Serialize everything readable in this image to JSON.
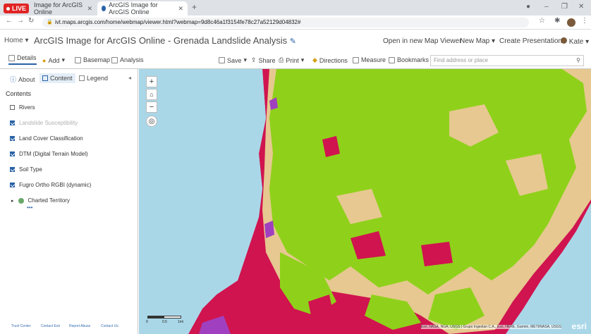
{
  "browser": {
    "live_label": "LIVE",
    "tabs": [
      {
        "title": "Image for ArcGIS Online"
      },
      {
        "title": "ArcGIS Image for ArcGIS Online"
      }
    ],
    "new_tab": "+",
    "url": "ivt.maps.arcgis.com/home/webmap/viewer.html?webmap=9d8c46a1f3154fe78c27a52129d04832#"
  },
  "header": {
    "home": "Home",
    "title": "ArcGIS Image for ArcGIS Online - Grenada Landslide Analysis",
    "open_viewer": "Open in new Map Viewer",
    "new_map": "New Map",
    "create_presentation": "Create Presentation",
    "user": "Kate"
  },
  "toolbar": {
    "details": "Details",
    "add": "Add",
    "basemap": "Basemap",
    "analysis": "Analysis",
    "save": "Save",
    "share": "Share",
    "print": "Print",
    "directions": "Directions",
    "measure": "Measure",
    "bookmarks": "Bookmarks",
    "search_placeholder": "Find address or place"
  },
  "panel": {
    "tabs": [
      "About",
      "Content",
      "Legend"
    ],
    "heading": "Contents",
    "layers": [
      {
        "name": "Rivers",
        "checked": false
      },
      {
        "name": "Landslide Susceptibility",
        "checked": true,
        "dim": true
      },
      {
        "name": "Land Cover Classification",
        "checked": true
      },
      {
        "name": "DTM (Digital Terrain Model)",
        "checked": true
      },
      {
        "name": "Soil Type",
        "checked": true
      },
      {
        "name": "Fugro Ortho RGBI (dynamic)",
        "checked": true
      }
    ],
    "group": "Charted Territory",
    "footer": [
      "Trust Center",
      "Contact Esri",
      "Report Abuse",
      "Contact Us"
    ]
  },
  "map": {
    "attribution": "Esri, NASA, NGA, USGS | Grupo Ingeolan C.A., Esri, HERE, Garmin, METI/NASA, USGS",
    "logo": "esri",
    "scale_labels": [
      "0",
      "0.5",
      "1mi"
    ],
    "colors": {
      "water": "#a9d7e8",
      "green": "#8fd11a",
      "tan": "#e6c890",
      "red": "#d0144f",
      "purple": "#a040c0"
    }
  }
}
